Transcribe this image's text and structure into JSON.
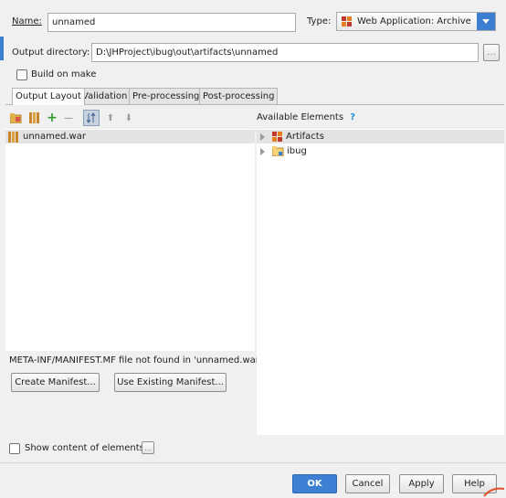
{
  "form": {
    "name_label": "Name:",
    "name_value": "unnamed",
    "type_label": "Type:",
    "type_value": "Web Application: Archive",
    "output_dir_label": "Output directory:",
    "output_dir_value": "D:\\JHProject\\ibug\\out\\artifacts\\unnamed",
    "browse_label": "...",
    "build_on_make_label": "Build on make",
    "build_on_make_checked": false
  },
  "tabs": [
    {
      "label": "Output Layout",
      "active": true
    },
    {
      "label": "Validation",
      "active": false
    },
    {
      "label": "Pre-processing",
      "active": false
    },
    {
      "label": "Post-processing",
      "active": false
    }
  ],
  "toolbar": {
    "icons": [
      "new-folder-icon",
      "archive-icon",
      "add-icon",
      "remove-icon",
      "sort-icon",
      "move-up-icon",
      "move-down-icon"
    ],
    "plus_glyph": "+",
    "minus_glyph": "—",
    "up_glyph": "⬆",
    "down_glyph": "⬇"
  },
  "layout_tree": {
    "items": [
      {
        "label": "unnamed.war",
        "icon": "war-archive-icon"
      }
    ]
  },
  "available": {
    "title": "Available Elements",
    "help_glyph": "?",
    "items": [
      {
        "label": "Artifacts",
        "icon": "artifacts-icon",
        "selected": true
      },
      {
        "label": "ibug",
        "icon": "module-folder-icon",
        "selected": false
      }
    ]
  },
  "manifest": {
    "message": "META-INF/MANIFEST.MF file not found in 'unnamed.war'",
    "create_label": "Create Manifest...",
    "use_existing_label": "Use Existing Manifest..."
  },
  "show_content": {
    "label": "Show content of elements",
    "checked": false,
    "more_label": "..."
  },
  "footer": {
    "ok_label": "OK",
    "cancel_label": "Cancel",
    "apply_label": "Apply",
    "help_label": "Help"
  },
  "colors": {
    "accent": "#3c7fd3",
    "selection": "#e3e3e3",
    "annotation": "#e0502b"
  }
}
